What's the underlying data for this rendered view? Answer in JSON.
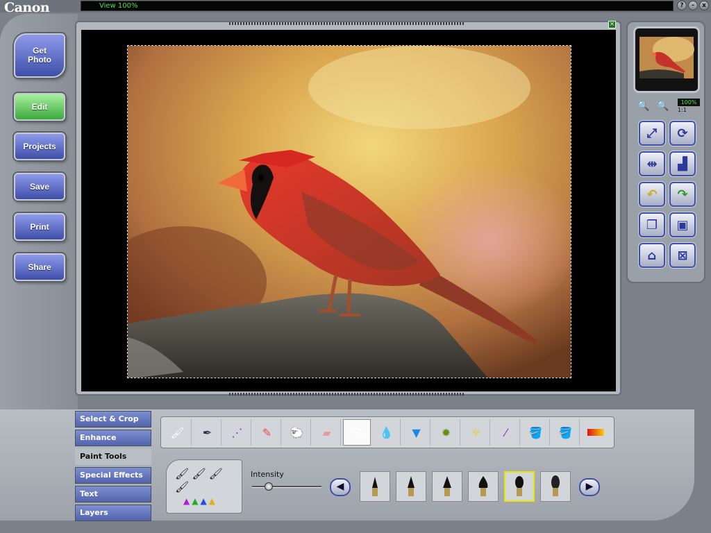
{
  "app": {
    "logo": "Canon"
  },
  "status": {
    "text": "View 100%"
  },
  "window_buttons": [
    "?",
    "-",
    "x"
  ],
  "nav": {
    "get_photo": "Get Photo",
    "edit": "Edit",
    "projects": "Projects",
    "save": "Save",
    "print": "Print",
    "share": "Share"
  },
  "zoom": {
    "level": "100%",
    "ratio": "1:1"
  },
  "right_tools": [
    {
      "icon": "fit-to-window-icon"
    },
    {
      "icon": "rotate-icon"
    },
    {
      "icon": "flip-horizontal-icon"
    },
    {
      "icon": "crop-page-icon"
    },
    {
      "icon": "undo-icon"
    },
    {
      "icon": "redo-icon"
    },
    {
      "icon": "duplicate-icon"
    },
    {
      "icon": "paste-icon"
    },
    {
      "icon": "restore-icon"
    },
    {
      "icon": "frame-icon"
    }
  ],
  "tabs": {
    "select_crop": "Select & Crop",
    "enhance": "Enhance",
    "paint_tools": "Paint Tools",
    "special_effects": "Special Effects",
    "text": "Text",
    "layers": "Layers"
  },
  "paint_tools": [
    {
      "icon": "brush-icon"
    },
    {
      "icon": "pen-icon"
    },
    {
      "icon": "spray-can-icon"
    },
    {
      "icon": "pencil-icon"
    },
    {
      "icon": "clone-stamp-icon"
    },
    {
      "icon": "eraser-icon"
    },
    {
      "icon": "red-eye-icon"
    },
    {
      "icon": "water-drop-icon"
    },
    {
      "icon": "sharpen-cone-icon"
    },
    {
      "icon": "brightness-icon"
    },
    {
      "icon": "lighten-icon"
    },
    {
      "icon": "eyedropper-icon"
    },
    {
      "icon": "paint-bucket-icon"
    },
    {
      "icon": "fill-tool-icon"
    },
    {
      "icon": "gradient-icon"
    }
  ],
  "selected_paint_tool": 6,
  "intensity": {
    "label": "Intensity",
    "value": 0.2
  },
  "brush_tips_selected": 4,
  "colors": {
    "accent_blue": "#3e4fa8",
    "active_green": "#3ca83c",
    "status_green": "#52e052",
    "selection_yellow": "#e8e800"
  }
}
